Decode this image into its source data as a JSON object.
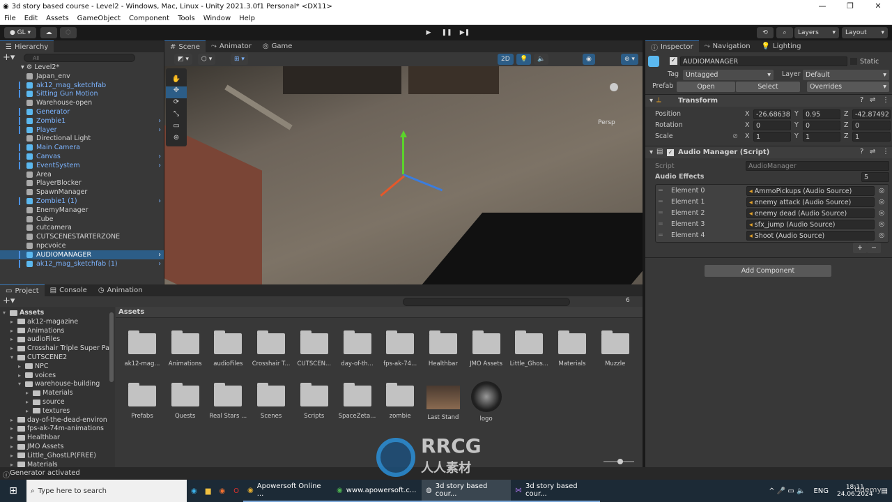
{
  "window": {
    "title": "3d story based course - Level2 - Windows, Mac, Linux - Unity 2021.3.0f1 Personal* <DX11>"
  },
  "menu": [
    "File",
    "Edit",
    "Assets",
    "GameObject",
    "Component",
    "Tools",
    "Window",
    "Help"
  ],
  "toolbar": {
    "account": "GL",
    "layers": "Layers",
    "layout": "Layout"
  },
  "hierarchy": {
    "tab": "Hierarchy",
    "search_placeholder": "All",
    "scene": "Level2*",
    "items": [
      {
        "label": "Japan_env",
        "prefab": false,
        "arrow": false
      },
      {
        "label": "ak12_mag_sketchfab",
        "prefab": true,
        "arrow": false
      },
      {
        "label": "Sitting Gun Motion",
        "prefab": true,
        "arrow": false
      },
      {
        "label": "Warehouse-open",
        "prefab": false,
        "arrow": false
      },
      {
        "label": "Generator",
        "prefab": true,
        "arrow": false
      },
      {
        "label": "Zombie1",
        "prefab": true,
        "arrow": true
      },
      {
        "label": "Player",
        "prefab": true,
        "arrow": true
      },
      {
        "label": "Directional Light",
        "prefab": false,
        "arrow": false
      },
      {
        "label": "Main Camera",
        "prefab": true,
        "arrow": false
      },
      {
        "label": "Canvas",
        "prefab": true,
        "arrow": true
      },
      {
        "label": "EventSystem",
        "prefab": true,
        "arrow": true
      },
      {
        "label": "Area",
        "prefab": false,
        "arrow": false
      },
      {
        "label": "PlayerBlocker",
        "prefab": false,
        "arrow": false
      },
      {
        "label": "SpawnManager",
        "prefab": false,
        "arrow": false
      },
      {
        "label": "Zombie1 (1)",
        "prefab": true,
        "arrow": true
      },
      {
        "label": "EnemyManager",
        "prefab": false,
        "arrow": false
      },
      {
        "label": "Cube",
        "prefab": false,
        "arrow": false
      },
      {
        "label": "cutcamera",
        "prefab": false,
        "arrow": false
      },
      {
        "label": "CUTSCENESTARTERZONE",
        "prefab": false,
        "arrow": false
      },
      {
        "label": "npcvoice",
        "prefab": false,
        "arrow": false
      },
      {
        "label": "AUDIOMANAGER",
        "prefab": true,
        "arrow": true,
        "selected": true
      },
      {
        "label": "ak12_mag_sketchfab (1)",
        "prefab": true,
        "arrow": true
      }
    ]
  },
  "scene": {
    "tabs": [
      "Scene",
      "Animator",
      "Game"
    ],
    "mode_2d": "2D",
    "persp": "Persp"
  },
  "inspector": {
    "tabs": [
      "Inspector",
      "Navigation",
      "Lighting"
    ],
    "name": "AUDIOMANAGER",
    "static": "Static",
    "tag_label": "Tag",
    "tag": "Untagged",
    "layer_label": "Layer",
    "layer": "Default",
    "prefab_label": "Prefab",
    "open": "Open",
    "select": "Select",
    "overrides": "Overrides",
    "transform": {
      "title": "Transform",
      "position_label": "Position",
      "rotation_label": "Rotation",
      "scale_label": "Scale",
      "position": [
        "-26.68638",
        "0.95",
        "-42.87492"
      ],
      "rotation": [
        "0",
        "0",
        "0"
      ],
      "scale": [
        "1",
        "1",
        "1"
      ]
    },
    "script_component": {
      "title": "Audio Manager (Script)",
      "script_label": "Script",
      "script": "AudioManager",
      "list_label": "Audio Effects",
      "count": "5",
      "elements": [
        {
          "label": "Element 0",
          "value": "AmmoPickups (Audio Source)"
        },
        {
          "label": "Element 1",
          "value": "enemy attack (Audio Source)"
        },
        {
          "label": "Element 2",
          "value": "enemy dead (Audio Source)"
        },
        {
          "label": "Element 3",
          "value": "sfx_jump (Audio Source)"
        },
        {
          "label": "Element 4",
          "value": "Shoot (Audio Source)"
        }
      ]
    },
    "add_component": "Add Component"
  },
  "project": {
    "tabs": [
      "Project",
      "Console",
      "Animation"
    ],
    "breadcrumb": "Assets",
    "hidden_count": "6",
    "tree": [
      {
        "label": "Assets",
        "d": 0,
        "open": true,
        "bold": true
      },
      {
        "label": "ak12-magazine",
        "d": 1
      },
      {
        "label": "Animations",
        "d": 1
      },
      {
        "label": "audioFiles",
        "d": 1
      },
      {
        "label": "Crosshair Triple Super Pac",
        "d": 1
      },
      {
        "label": "CUTSCENE2",
        "d": 1,
        "open": true
      },
      {
        "label": "NPC",
        "d": 2
      },
      {
        "label": "voices",
        "d": 2
      },
      {
        "label": "warehouse-building",
        "d": 2,
        "open": true
      },
      {
        "label": "Materials",
        "d": 3
      },
      {
        "label": "source",
        "d": 3
      },
      {
        "label": "textures",
        "d": 3
      },
      {
        "label": "day-of-the-dead-environ",
        "d": 1
      },
      {
        "label": "fps-ak-74m-animations",
        "d": 1
      },
      {
        "label": "Healthbar",
        "d": 1
      },
      {
        "label": "JMO Assets",
        "d": 1
      },
      {
        "label": "Little_GhostLP(FREE)",
        "d": 1
      },
      {
        "label": "Materials",
        "d": 1
      }
    ],
    "assets": [
      "ak12-mag...",
      "Animations",
      "audioFiles",
      "Crosshair T...",
      "CUTSCEN...",
      "day-of-th...",
      "fps-ak-74...",
      "Healthbar",
      "JMO Assets",
      "Little_Ghos...",
      "Materials",
      "Muzzle",
      "Prefabs",
      "Quests",
      "Real Stars ...",
      "Scenes",
      "Scripts",
      "SpaceZeta...",
      "zombie",
      "Last Stand",
      "logo"
    ]
  },
  "status": "Generator activated",
  "watermark": "RRCG 人人素材",
  "taskbar": {
    "search": "Type here to search",
    "apps": [
      "Apowersoft Online ...",
      "www.apowersoft.c...",
      "3d story based cour...",
      "3d story based cour..."
    ],
    "lang": "ENG",
    "time": "18:11",
    "date": "24.06.2024",
    "udemy": "Udemy"
  }
}
